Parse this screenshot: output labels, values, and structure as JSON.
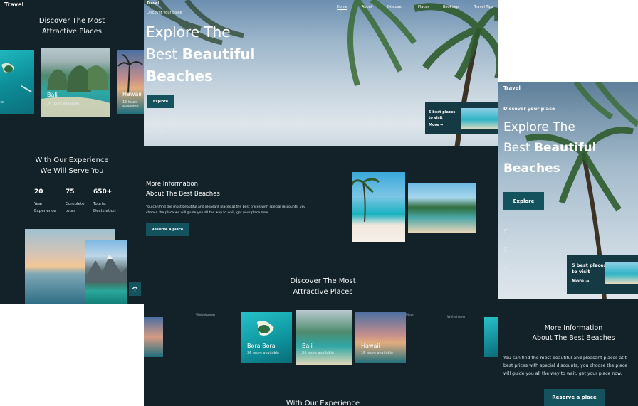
{
  "brand": "Travel",
  "nav": {
    "home": "Home",
    "about": "About",
    "discover": "Discover",
    "places": "Places",
    "bookings": "Bookings",
    "travel_tips": "Travel Tips"
  },
  "hero": {
    "subtitle": "Discover your place",
    "title_line1": "Explore The",
    "title_best": "Best",
    "title_beautiful": "Beautiful",
    "title_line3": "Beaches",
    "explore_button": "Explore"
  },
  "info_card": {
    "line1": "5 best places",
    "line2": "to visit",
    "more": "More →"
  },
  "discover": {
    "title_line1": "Discover The Most",
    "title_line2": "Attractive Places",
    "cards": [
      {
        "name": "Bora Bora",
        "sub": "36 tours available"
      },
      {
        "name": "Bali",
        "sub": "24 tours available"
      },
      {
        "name": "Hawaii",
        "sub": "15 tours available"
      }
    ],
    "broken_images": [
      "Whitehaven",
      "Moor",
      "Whitehaven"
    ]
  },
  "experience": {
    "title_line1": "With Our Experience",
    "title_line2": "We Will Serve You",
    "stats": [
      {
        "num": "20",
        "label1": "Year",
        "label2": "Experience"
      },
      {
        "num": "75",
        "label1": "Complete",
        "label2": "tours"
      },
      {
        "num": "650+",
        "label1": "Tourist",
        "label2": "Destination"
      }
    ]
  },
  "about": {
    "title_line1": "More Information",
    "title_line2": "About The Best Beaches",
    "body": "You can find the most beautiful and pleasant places at the best prices with special discounts, you choose the place we will guide you all the way to wait, get your place now.",
    "reserve_button": "Reserve a place"
  },
  "mobile_right": {
    "body_line1": "You can find the most beautiful and pleasant places at t",
    "body_line2": "best prices with special discounts, you choose the place",
    "body_line3": "will guide you all the way to wait, get your place now."
  },
  "icons": {
    "scroll_up": "arrow-up-icon",
    "facebook": "facebook-icon",
    "instagram": "instagram-icon",
    "twitter": "twitter-icon"
  },
  "colors": {
    "dark_bg": "#132228",
    "accent_button": "#14535e",
    "card_bg": "#153a44"
  }
}
